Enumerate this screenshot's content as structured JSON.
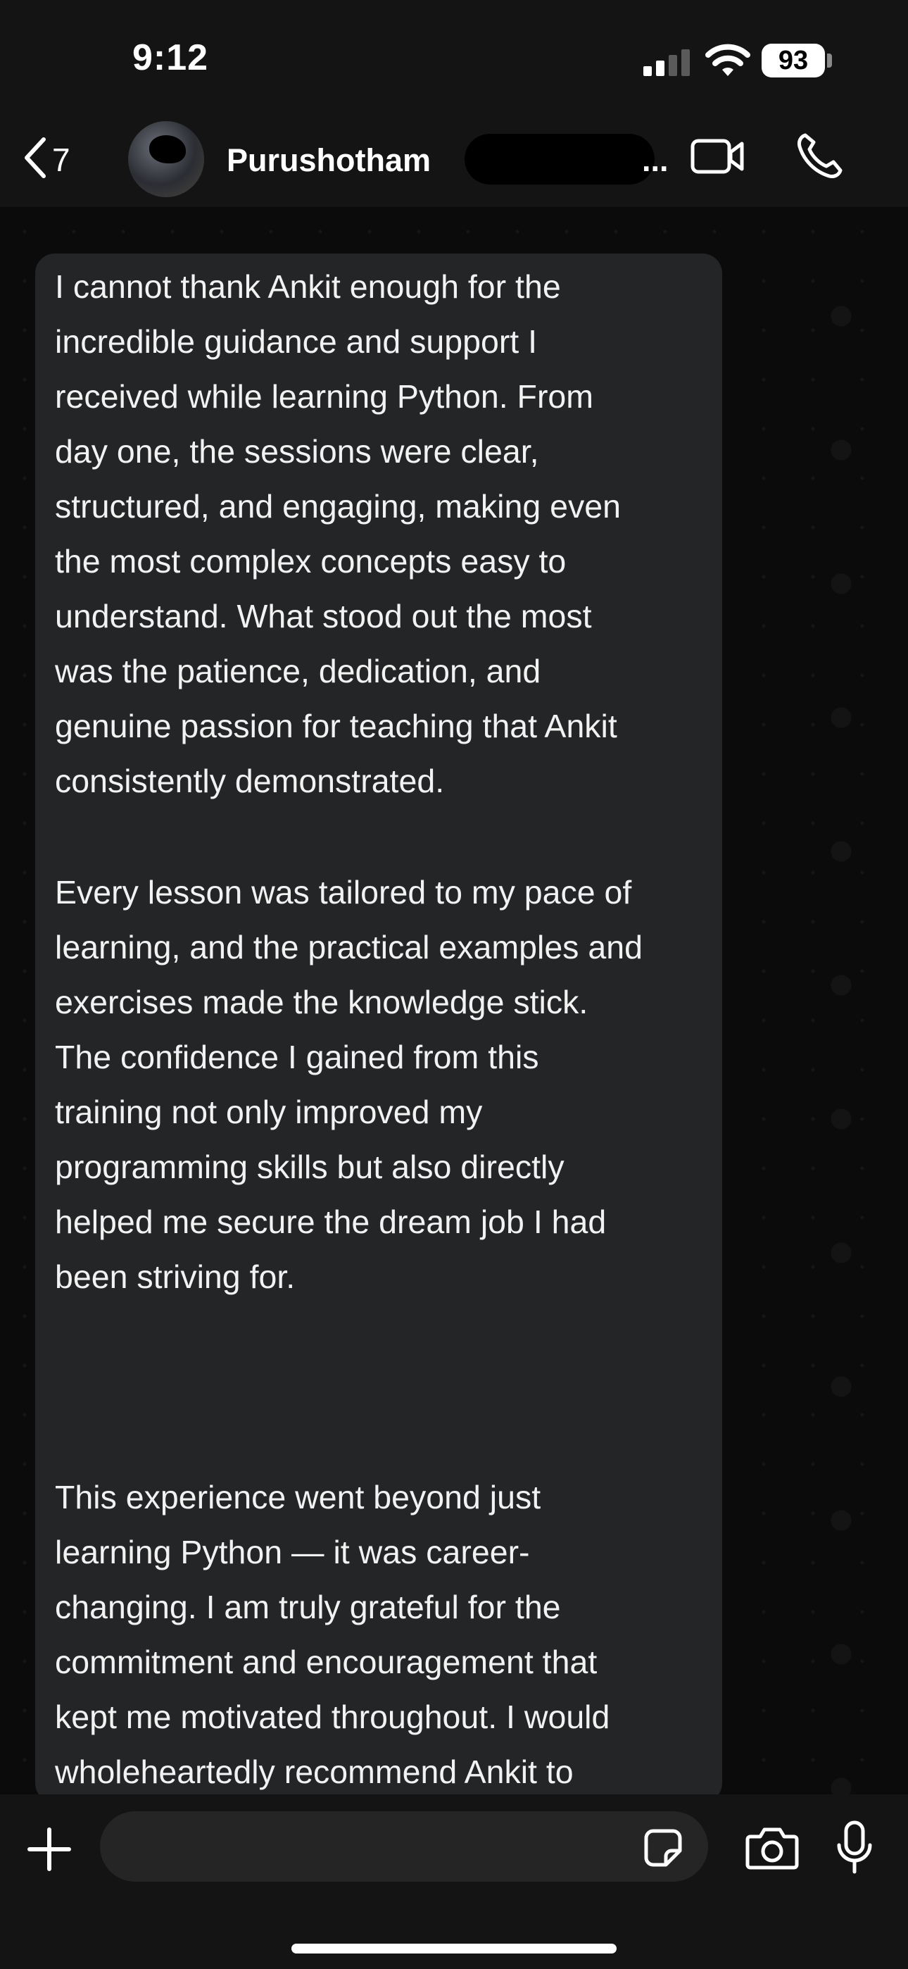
{
  "status_bar": {
    "time": "9:12",
    "battery": "93"
  },
  "header": {
    "back_count": "7",
    "contact_name": "Purushotham",
    "name_trailing": "...",
    "icons": [
      "chevron-left-icon",
      "video-icon",
      "phone-icon"
    ]
  },
  "message": {
    "paragraph_1": "I cannot thank Ankit enough for the\nincredible guidance and support I\nreceived while learning Python. From\nday one, the sessions were clear,\nstructured, and engaging, making even\nthe most complex concepts easy to\nunderstand. What stood out the most\nwas the patience, dedication, and\ngenuine passion for teaching that Ankit\nconsistently demonstrated.",
    "paragraph_2": "Every lesson was tailored to my pace of\nlearning, and the practical examples and\nexercises made the knowledge stick.\nThe confidence I gained from this\ntraining not only improved my\nprogramming skills but also directly\nhelped me secure the dream job I had\nbeen striving for.",
    "paragraph_3": "This experience went beyond just\nlearning Python — it was career-\nchanging. I am truly grateful for the\ncommitment and encouragement that\nkept me motivated throughout. I would\nwholeheartedly recommend Ankit to\nanyone who is serious about mastering\nPython and advancing their career."
  },
  "composer": {
    "placeholder": "",
    "icons": [
      "plus-icon",
      "sticker-icon",
      "camera-icon",
      "microphone-icon"
    ]
  },
  "colors": {
    "bubble": "#242526",
    "bar": "#141414",
    "background": "#0b0b0b"
  }
}
